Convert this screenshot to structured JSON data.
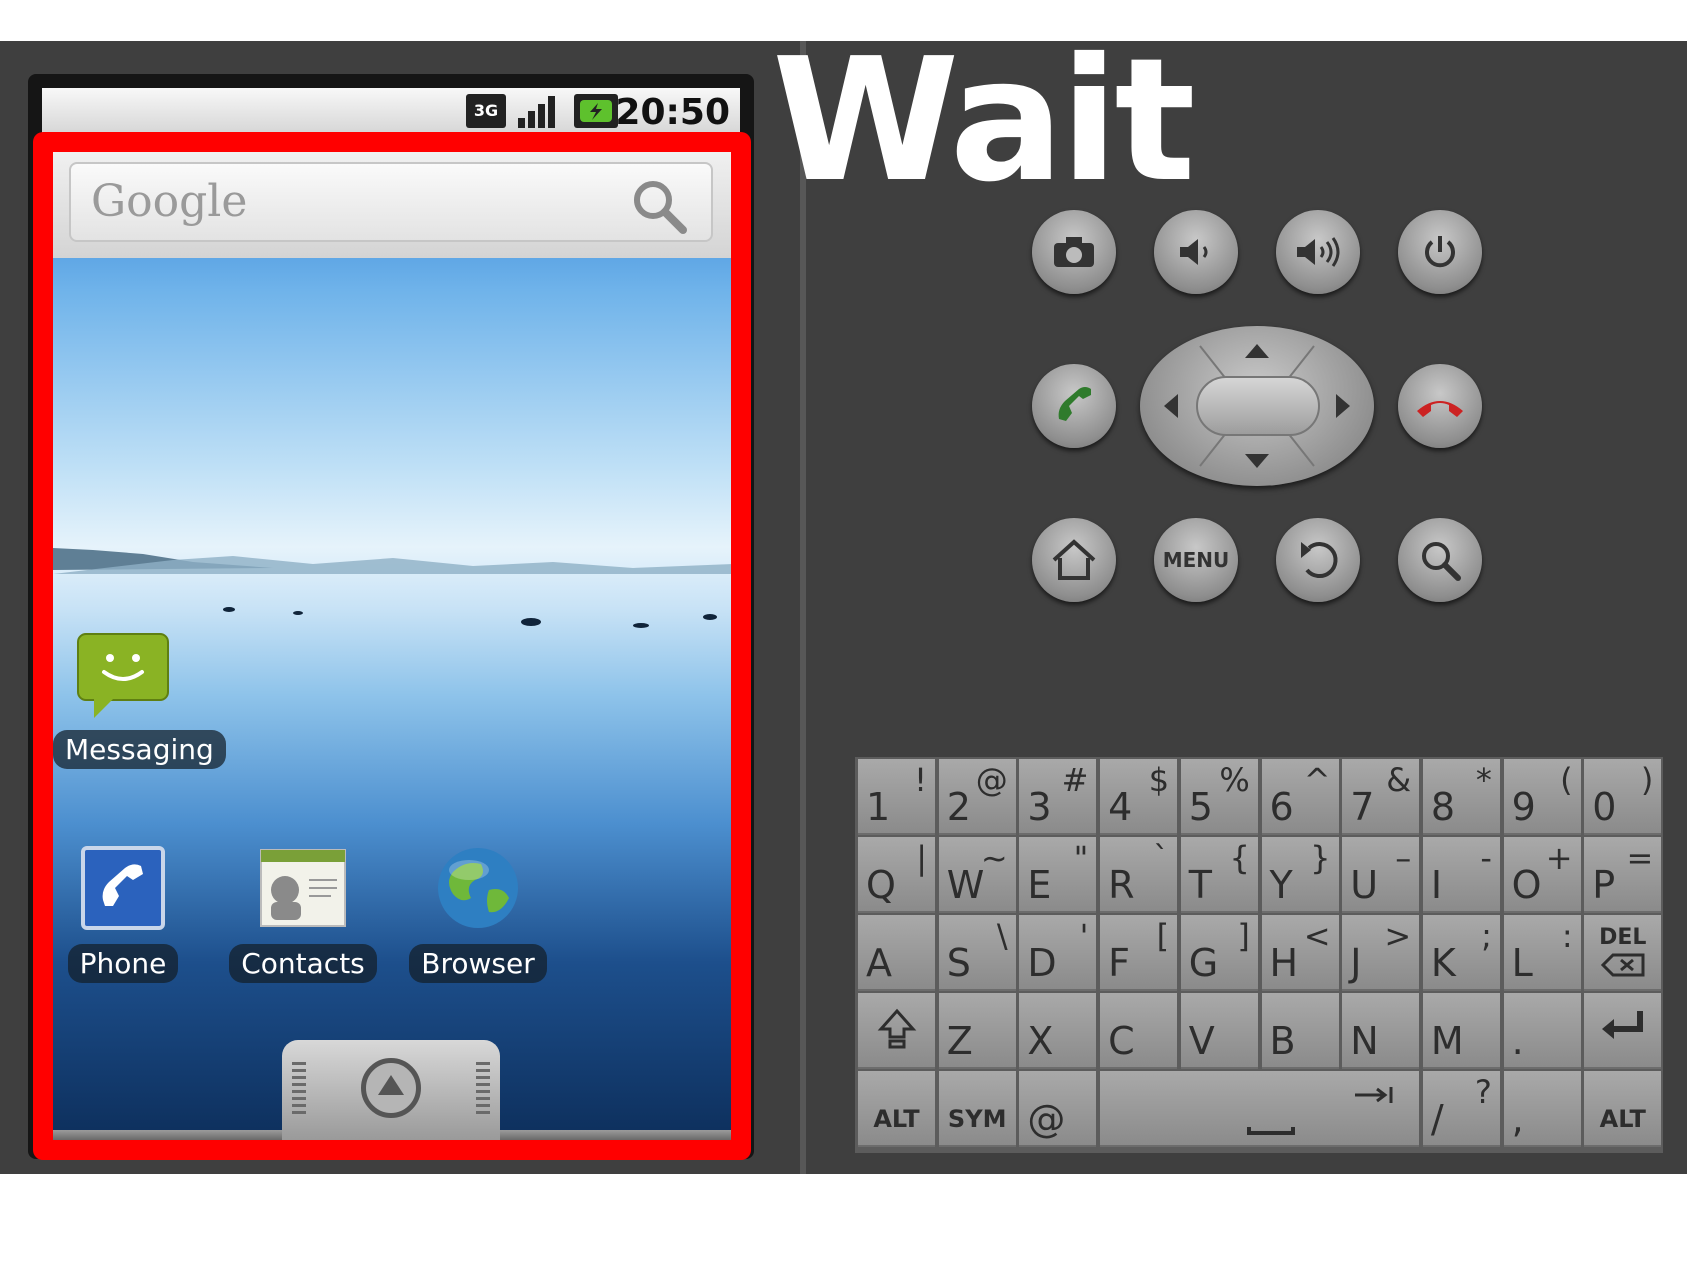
{
  "overlay_text": "Wait",
  "status_bar": {
    "network": "3G",
    "time": "20:50"
  },
  "home": {
    "search_brand": "Google",
    "apps": [
      {
        "label": "Messaging"
      },
      {
        "label": "Phone"
      },
      {
        "label": "Contacts"
      },
      {
        "label": "Browser"
      }
    ]
  },
  "hardware": {
    "row1": [
      "camera-icon",
      "volume-down-icon",
      "volume-up-icon",
      "power-icon"
    ],
    "row2": [
      "call-icon",
      "dpad",
      "end-call-icon"
    ],
    "row3": [
      "home-icon",
      "menu",
      "back-icon",
      "search-icon"
    ],
    "menu_label": "MENU"
  },
  "keyboard": {
    "row1": [
      [
        "1",
        "!"
      ],
      [
        "2",
        "@"
      ],
      [
        "3",
        "#"
      ],
      [
        "4",
        "$"
      ],
      [
        "5",
        "%"
      ],
      [
        "6",
        "^"
      ],
      [
        "7",
        "&"
      ],
      [
        "8",
        "*"
      ],
      [
        "9",
        "("
      ],
      [
        "0",
        ")"
      ]
    ],
    "row2": [
      [
        "Q",
        "|"
      ],
      [
        "W",
        "~"
      ],
      [
        "E",
        "\""
      ],
      [
        "R",
        "`"
      ],
      [
        "T",
        "{"
      ],
      [
        "Y",
        "}"
      ],
      [
        "U",
        "–"
      ],
      [
        "I",
        "-"
      ],
      [
        "O",
        "+"
      ],
      [
        "P",
        "="
      ]
    ],
    "row3": [
      [
        "A",
        ""
      ],
      [
        "S",
        "\\"
      ],
      [
        "D",
        "'"
      ],
      [
        "F",
        "["
      ],
      [
        "G",
        "]"
      ],
      [
        "H",
        "<"
      ],
      [
        "J",
        ">"
      ],
      [
        "K",
        ";"
      ],
      [
        "L",
        ":"
      ]
    ],
    "row3_del": "DEL",
    "row4": [
      [
        "Z",
        ""
      ],
      [
        "X",
        ""
      ],
      [
        "C",
        ""
      ],
      [
        "V",
        ""
      ],
      [
        "B",
        ""
      ],
      [
        "N",
        ""
      ],
      [
        "M",
        ""
      ],
      [
        ".",
        ""
      ]
    ],
    "row5": {
      "alt_left": "ALT",
      "sym": "SYM",
      "at": "@",
      "slash": "/",
      "slash_alt": "?",
      "comma": ",",
      "alt_right": "ALT"
    }
  },
  "colors": {
    "highlight": "#ff0000",
    "emulator_bg": "#3f3f3f"
  }
}
